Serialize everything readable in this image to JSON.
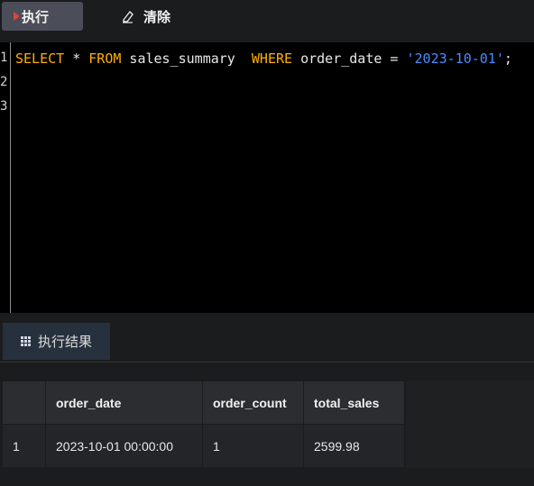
{
  "toolbar": {
    "run_label": "执行",
    "clear_label": "清除",
    "run_icon": "play-icon",
    "clear_icon": "eraser-icon"
  },
  "editor": {
    "line_numbers": [
      "1",
      "2",
      "3"
    ],
    "tokens": {
      "select": "SELECT",
      "star": " * ",
      "from": "FROM",
      "table": " sales_summary  ",
      "where": "WHERE",
      "cond": " order_date = ",
      "value": "'2023-10-01'",
      "end": ";"
    }
  },
  "tabs": {
    "result_label": "执行结果",
    "result_icon": "table-grid-icon"
  },
  "results": {
    "columns": [
      "",
      "order_date",
      "order_count",
      "total_sales"
    ],
    "rows": [
      [
        "1",
        "2023-10-01 00:00:00",
        "1",
        "2599.98"
      ]
    ]
  },
  "colors": {
    "keyword": "#ffb000",
    "string": "#4a8dff",
    "run_icon": "#d9473c"
  }
}
